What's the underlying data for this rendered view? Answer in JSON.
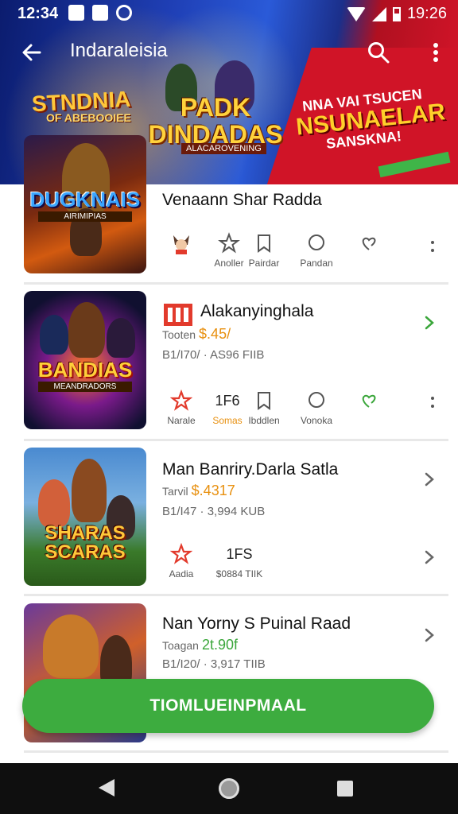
{
  "status_bar": {
    "time": "12:34",
    "right_text": "19:26"
  },
  "toolbar": {
    "title": "Indaraleisia"
  },
  "banner": {
    "left_title": "STNDNIA",
    "left_sub": "OF ABEBOOIEE",
    "mid_title": "PADK DINDADAS",
    "mid_sub": "ALACAROVENING",
    "right_small": "NNA VAI TSUCEN",
    "right_big": "NSUNAELAR",
    "right_sub": "SANSKNA!"
  },
  "apps": [
    {
      "thumb_label": "DUGKNAIS",
      "thumb_sub": "AIRIMIPIAS",
      "title": "Venaann Shar Radda",
      "actions": [
        {
          "label": "",
          "icon": "avatar-icon"
        },
        {
          "label": "Anoller",
          "icon": "star-icon"
        },
        {
          "label": "Pairdar",
          "icon": "bookmark-icon"
        },
        {
          "label": "Pandan",
          "icon": "chat-icon"
        },
        {
          "label": "",
          "icon": "heart-icon"
        }
      ]
    },
    {
      "thumb_label": "BANDIAS",
      "thumb_sub": "MEANDRADORS",
      "title": "Alakanyinghala",
      "developer": "Tooten",
      "price": "$.45/",
      "meta": "B1/I70/ · AS96 FIIB",
      "count": "1F6",
      "actions": [
        {
          "label": "Narale",
          "icon": "star-icon"
        },
        {
          "label": "Somas",
          "icon": "count"
        },
        {
          "label": "Ibddlen",
          "icon": "bookmark-icon"
        },
        {
          "label": "Vonoka",
          "icon": "chat-icon"
        },
        {
          "label": "",
          "icon": "heart-icon"
        }
      ]
    },
    {
      "thumb_label": "SHARAS SCARAS",
      "thumb_sub": "",
      "title": "Man Banriry.Darla Satla",
      "developer": "Tarvil",
      "price": "$.4317",
      "meta": "B1/I47 · 3,994 KUB",
      "count": "1FS",
      "actions": [
        {
          "label": "Aadia",
          "icon": "star-icon"
        },
        {
          "label": "$0884 TIIK",
          "icon": "count"
        }
      ]
    },
    {
      "thumb_label": "",
      "thumb_sub": "",
      "title": "Nan Yorny S Puinal Raad",
      "developer": "Toagan",
      "price": "2t.90f",
      "meta": "B1/I20/ · 3,917 TIIB"
    }
  ],
  "install_button": "TIOMLUEINPMAAL",
  "colors": {
    "accent_green": "#3dac3f",
    "price_orange": "#e8900f",
    "price_green": "#3aa63a",
    "star_red": "#e23a2c"
  }
}
